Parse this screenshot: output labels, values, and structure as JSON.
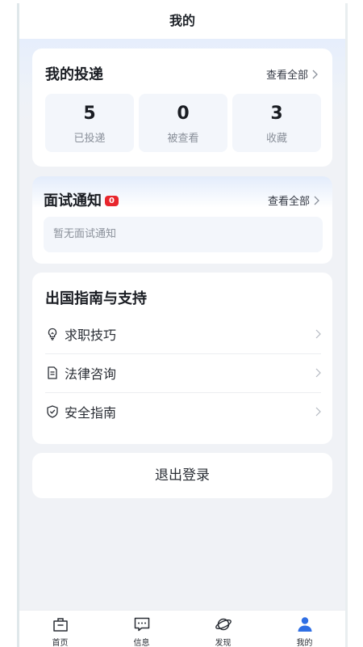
{
  "header": {
    "title": "我的"
  },
  "applications": {
    "title": "我的投递",
    "view_all": "查看全部",
    "stats": [
      {
        "value": "5",
        "label": "已投递"
      },
      {
        "value": "0",
        "label": "被查看"
      },
      {
        "value": "3",
        "label": "收藏"
      }
    ]
  },
  "interviews": {
    "title": "面试通知",
    "badge": "0",
    "view_all": "查看全部",
    "empty_text": "暂无面试通知"
  },
  "guide": {
    "title": "出国指南与支持",
    "items": [
      {
        "label": "求职技巧",
        "icon": "lightbulb-icon"
      },
      {
        "label": "法律咨询",
        "icon": "document-icon"
      },
      {
        "label": "安全指南",
        "icon": "shield-check-icon"
      }
    ]
  },
  "logout": {
    "label": "退出登录"
  },
  "tabbar": {
    "items": [
      {
        "label": "首页",
        "icon": "briefcase-icon",
        "active": false
      },
      {
        "label": "信息",
        "icon": "message-icon",
        "active": false
      },
      {
        "label": "发现",
        "icon": "planet-icon",
        "active": false
      },
      {
        "label": "我的",
        "icon": "user-icon",
        "active": true
      }
    ],
    "active_color": "#2f6fe4"
  }
}
